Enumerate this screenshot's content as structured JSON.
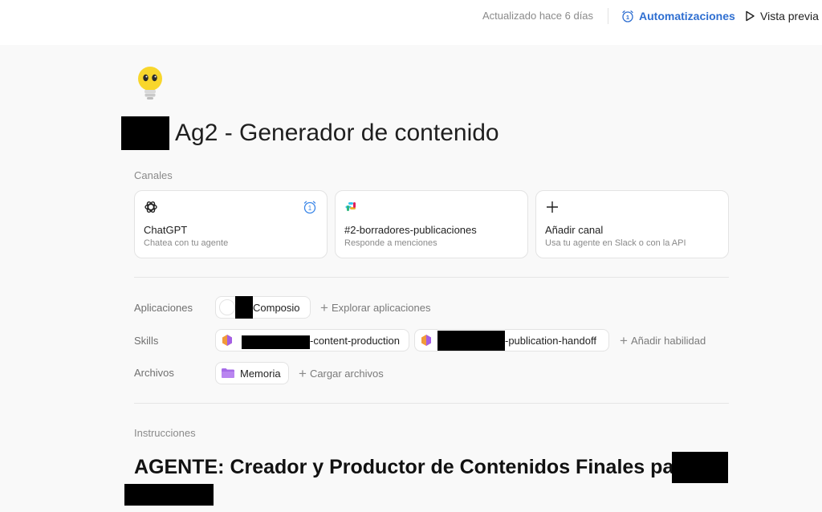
{
  "topbar": {
    "updated": "Actualizado hace 6 días",
    "automations_label": "Automatizaciones",
    "automations_badge": "1",
    "preview_label": "Vista previa"
  },
  "agent": {
    "title": "Ag2 - Generador de contenido",
    "icon": "lightbulb-face-emoji"
  },
  "channels": {
    "label": "Canales",
    "items": [
      {
        "title": "ChatGPT",
        "subtitle": "Chatea con tu agente",
        "icon": "openai-icon",
        "badge": "1"
      },
      {
        "title": "#2-borradores-publicaciones",
        "subtitle": "Responde a menciones",
        "icon": "slack-icon"
      },
      {
        "title": "Añadir canal",
        "subtitle": "Usa tu agente en Slack o con la API",
        "icon": "plus-icon"
      }
    ]
  },
  "apps": {
    "label": "Aplicaciones",
    "items": [
      {
        "name": "Composio"
      }
    ],
    "add_label": "Explorar aplicaciones"
  },
  "skills": {
    "label": "Skills",
    "items": [
      {
        "name": "-content-production"
      },
      {
        "name": "-publication-handoff"
      }
    ],
    "add_label": "Añadir habilidad"
  },
  "files": {
    "label": "Archivos",
    "items": [
      {
        "name": "Memoria",
        "icon": "folder-icon"
      }
    ],
    "add_label": "Cargar archivos"
  },
  "instructions": {
    "label": "Instrucciones",
    "heading": "AGENTE: Creador y Productor de Contenidos Finales para"
  },
  "colors": {
    "accent": "#2f6fd1",
    "background": "#f9f9f9",
    "folder": "#a66be8"
  }
}
